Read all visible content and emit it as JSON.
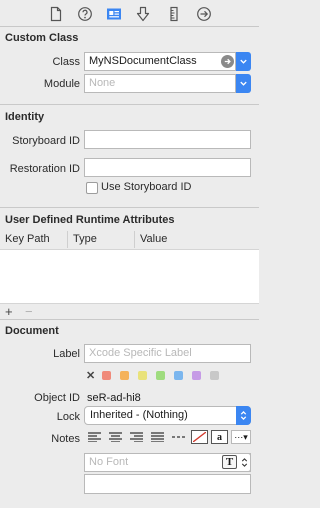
{
  "custom_class": {
    "title": "Custom Class",
    "class_label": "Class",
    "class_value": "MyNSDocumentClass",
    "module_label": "Module",
    "module_placeholder": "None"
  },
  "identity": {
    "title": "Identity",
    "storyboard_id_label": "Storyboard ID",
    "storyboard_id_value": "",
    "restoration_id_label": "Restoration ID",
    "restoration_id_value": "",
    "use_storyboard_id_label": "Use Storyboard ID",
    "use_storyboard_id_checked": false
  },
  "runtime_attributes": {
    "title": "User Defined Runtime Attributes",
    "columns": [
      "Key Path",
      "Type",
      "Value"
    ],
    "rows": [],
    "add_label": "+",
    "remove_label": "−"
  },
  "document": {
    "title": "Document",
    "label_label": "Label",
    "label_placeholder": "Xcode Specific Label",
    "label_colors": [
      "#f08a7a",
      "#f5b25a",
      "#e9e27a",
      "#9fdc7e",
      "#7bb6ee",
      "#c69be6",
      "#c8c8c8"
    ],
    "object_id_label": "Object ID",
    "object_id_value": "seR-ad-hi8",
    "lock_label": "Lock",
    "lock_value": "Inherited - (Nothing)",
    "notes_label": "Notes",
    "font_placeholder": "No Font"
  },
  "toolbar": {
    "icons": [
      "file-inspector-icon",
      "quick-help-icon",
      "identity-inspector-icon",
      "attributes-inspector-icon",
      "size-inspector-icon",
      "connections-inspector-icon"
    ],
    "selected": "identity-inspector-icon"
  },
  "colors": {
    "accent": "#3b86f2",
    "background": "#ececec"
  }
}
